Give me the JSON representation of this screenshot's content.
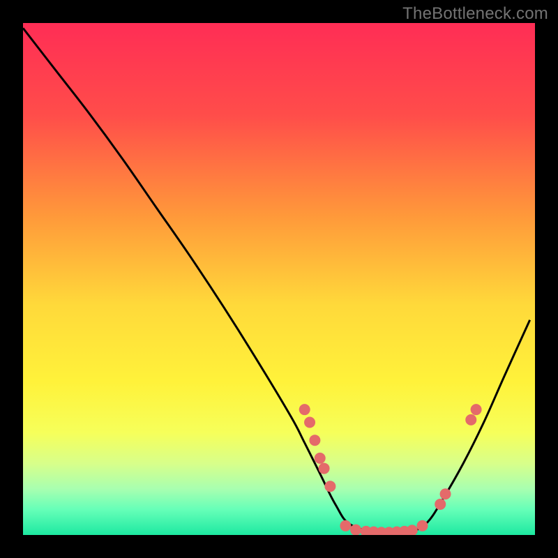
{
  "watermark": "TheBottleneck.com",
  "chart_data": {
    "type": "line",
    "title": "",
    "xlabel": "",
    "ylabel": "",
    "xlim": [
      0,
      100
    ],
    "ylim": [
      0,
      100
    ],
    "gradient_stops": [
      {
        "offset": 0.0,
        "color": "#ff2d55"
      },
      {
        "offset": 0.18,
        "color": "#ff4d4a"
      },
      {
        "offset": 0.38,
        "color": "#ff9a3a"
      },
      {
        "offset": 0.55,
        "color": "#ffd93a"
      },
      {
        "offset": 0.7,
        "color": "#fff23a"
      },
      {
        "offset": 0.8,
        "color": "#f6ff5a"
      },
      {
        "offset": 0.86,
        "color": "#d8ff8a"
      },
      {
        "offset": 0.91,
        "color": "#a8ffb0"
      },
      {
        "offset": 0.95,
        "color": "#66ffb8"
      },
      {
        "offset": 1.0,
        "color": "#1de9a1"
      }
    ],
    "series": [
      {
        "name": "bottleneck-curve",
        "x": [
          0.0,
          6.2,
          12.8,
          19.4,
          26.0,
          32.6,
          39.2,
          45.8,
          52.4,
          55.0,
          58.0,
          61.0,
          64.0,
          70.0,
          76.0,
          79.0,
          82.0,
          86.0,
          90.0,
          94.0,
          99.0
        ],
        "y": [
          99.0,
          91.0,
          82.5,
          73.5,
          64.0,
          54.5,
          44.5,
          34.0,
          23.0,
          18.0,
          12.0,
          6.0,
          2.0,
          0.5,
          0.8,
          2.5,
          7.0,
          14.0,
          22.0,
          31.0,
          42.0
        ]
      }
    ],
    "markers": {
      "name": "highlight-dots",
      "color": "#e46a6a",
      "radius_px": 8,
      "points": [
        {
          "x": 55.0,
          "y": 24.5
        },
        {
          "x": 56.0,
          "y": 22.0
        },
        {
          "x": 57.0,
          "y": 18.5
        },
        {
          "x": 58.0,
          "y": 15.0
        },
        {
          "x": 58.8,
          "y": 13.0
        },
        {
          "x": 60.0,
          "y": 9.5
        },
        {
          "x": 63.0,
          "y": 1.8
        },
        {
          "x": 65.0,
          "y": 1.0
        },
        {
          "x": 67.0,
          "y": 0.7
        },
        {
          "x": 68.5,
          "y": 0.6
        },
        {
          "x": 70.0,
          "y": 0.5
        },
        {
          "x": 71.5,
          "y": 0.5
        },
        {
          "x": 73.0,
          "y": 0.6
        },
        {
          "x": 74.5,
          "y": 0.7
        },
        {
          "x": 76.0,
          "y": 0.9
        },
        {
          "x": 78.0,
          "y": 1.8
        },
        {
          "x": 81.5,
          "y": 6.0
        },
        {
          "x": 82.5,
          "y": 8.0
        },
        {
          "x": 87.5,
          "y": 22.5
        },
        {
          "x": 88.5,
          "y": 24.5
        }
      ]
    }
  }
}
